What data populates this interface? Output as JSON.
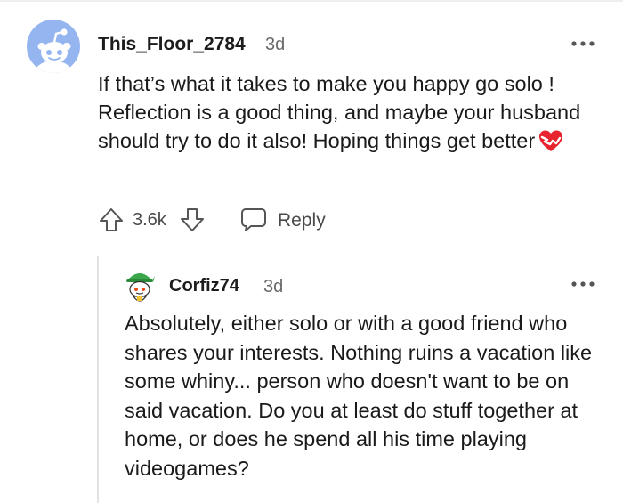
{
  "parent_comment": {
    "author": "This_Floor_2784",
    "time": "3d",
    "text": "If that’s what it takes to make you happy go solo ! Reflection is a good thing, and maybe your husband should try to do it also! Hoping things get better",
    "emoji": "heart-on-fire",
    "score": "3.6k",
    "reply_label": "Reply",
    "avatar_color": "#95b5f0"
  },
  "reply_comment": {
    "author": "Corfiz74",
    "time": "3d",
    "text": "Absolutely, either solo or with a good friend who shares your interests. Nothing ruins a vacation like some whiny... person who doesn't want to be on said vacation. Do you at least do stuff together at home, or does he spend all his time playing videogames?",
    "avatar_color": "#3aa84a"
  },
  "colors": {
    "text": "#1a1a1b",
    "meta": "#6a6a6a",
    "thread_line": "#e2e2e2",
    "emoji_red": "#e8242e"
  }
}
